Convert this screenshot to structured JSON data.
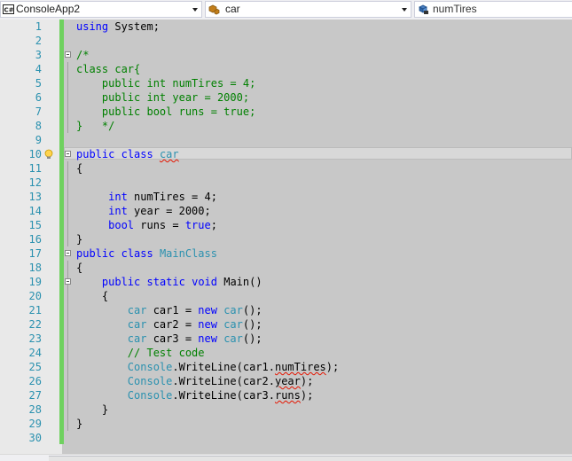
{
  "navbar": {
    "project": "ConsoleApp2",
    "project_icon": "C#",
    "type": "car",
    "member": "numTires"
  },
  "lines": [
    "using System;",
    "",
    "/*",
    "class car{",
    "    public int numTires = 4;",
    "    public int year = 2000;",
    "    public bool runs = true;",
    "}   */",
    "",
    "public class car",
    "{",
    "",
    "     int numTires = 4;",
    "     int year = 2000;",
    "     bool runs = true;",
    "}",
    "public class MainClass",
    "{",
    "    public static void Main()",
    "    {",
    "        car car1 = new car();",
    "        car car2 = new car();",
    "        car car3 = new car();",
    "        // Test code",
    "        Console.WriteLine(car1.numTires);",
    "        Console.WriteLine(car2.year);",
    "        Console.WriteLine(car3.runs);",
    "    }",
    "}",
    ""
  ],
  "line_numbers": [
    "1",
    "2",
    "3",
    "4",
    "5",
    "6",
    "7",
    "8",
    "9",
    "10",
    "11",
    "12",
    "13",
    "14",
    "15",
    "16",
    "17",
    "18",
    "19",
    "20",
    "21",
    "22",
    "23",
    "24",
    "25",
    "26",
    "27",
    "28",
    "29",
    "30"
  ],
  "colors": {
    "keyword": "#0000ff",
    "type": "#2b91af",
    "comment": "#008000",
    "line_number": "#2b91af",
    "change_bar": "#6fd15f",
    "error_squiggle": "#e51400"
  }
}
